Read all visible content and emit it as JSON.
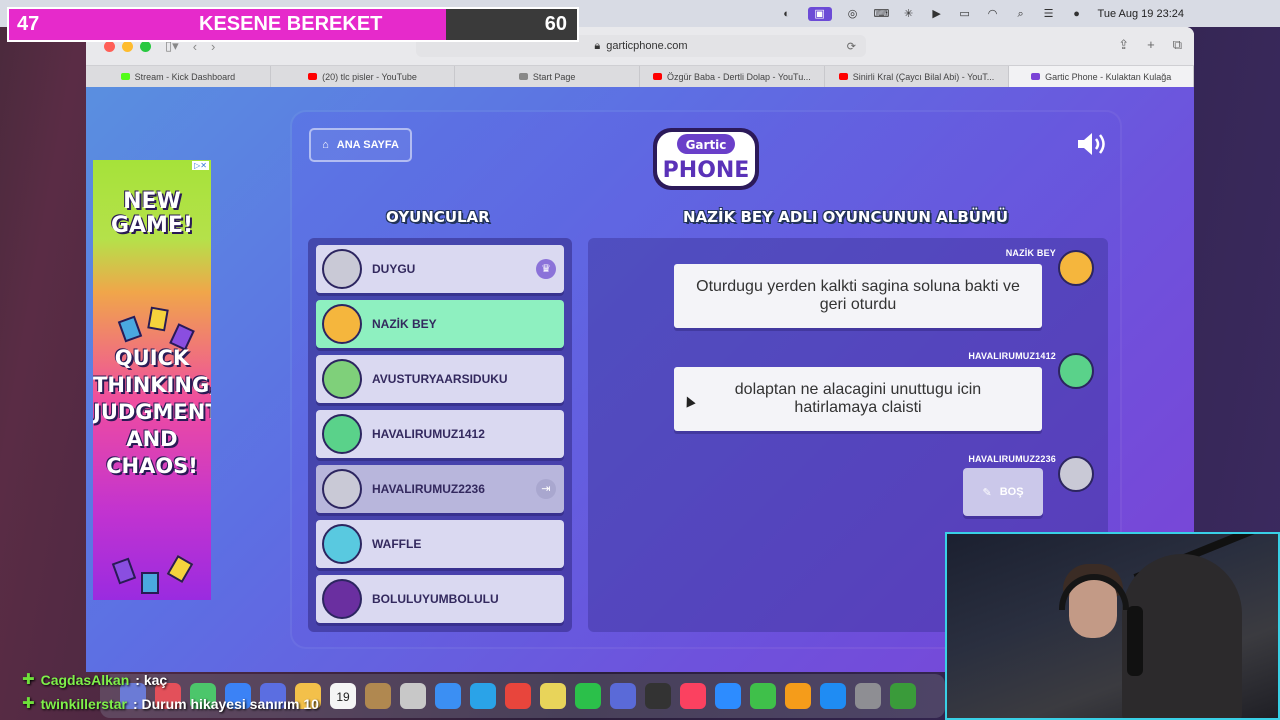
{
  "overlay": {
    "left_count": "47",
    "title": "KESENE BEREKET",
    "right_count": "60",
    "fill_fraction": 0.77
  },
  "menubar": {
    "clock": "Tue Aug 19  23:24"
  },
  "browser": {
    "url": "garticphone.com",
    "tabs": [
      {
        "label": "Stream - Kick Dashboard",
        "fav_color": "#53fc18"
      },
      {
        "label": "(20) tlc pisler - YouTube",
        "fav_color": "#ff0000"
      },
      {
        "label": "Start Page",
        "fav_color": "#888888"
      },
      {
        "label": "Özgür Baba - Dertli Dolap - YouTu...",
        "fav_color": "#ff0000"
      },
      {
        "label": "Sinirli Kral (Çaycı Bilal Abi) - YouT...",
        "fav_color": "#ff0000"
      },
      {
        "label": "Gartic Phone - Kulaktan Kulağa",
        "fav_color": "#7b43d6"
      }
    ]
  },
  "ad": {
    "headline": "NEW GAME!",
    "tagline": "QUICK THINKING, JUDGMENT AND CHAOS!"
  },
  "game": {
    "home_label": "ANA SAYFA",
    "logo_top": "Gartic",
    "logo_bottom": "PHONE",
    "players_title": "OYUNCULAR",
    "album_title": "NAZİK BEY ADLI OYUNCUNUN ALBÜMÜ",
    "players": [
      {
        "name": "DUYGU",
        "state": "normal",
        "badge": "crown",
        "avatar_color": "#c9c9d6"
      },
      {
        "name": "NAZİK BEY",
        "state": "active",
        "badge": "",
        "avatar_color": "#f5b63d"
      },
      {
        "name": "AVUSTURYAARSIDUKU",
        "state": "normal",
        "badge": "",
        "avatar_color": "#7fd07a"
      },
      {
        "name": "HAVALIRUMUZ1412",
        "state": "normal",
        "badge": "",
        "avatar_color": "#5ad28a"
      },
      {
        "name": "HAVALIRUMUZ2236",
        "state": "dim",
        "badge": "exit",
        "avatar_color": "#c9c9d6"
      },
      {
        "name": "WAFFLE",
        "state": "normal",
        "badge": "",
        "avatar_color": "#59c9e0"
      },
      {
        "name": "BOLULUYUMBOLULU",
        "state": "normal",
        "badge": "",
        "avatar_color": "#6a2fa0"
      }
    ],
    "album": [
      {
        "author": "NAZİK BEY",
        "text": "Oturdugu yerden kalkti sagina soluna bakti ve geri oturdu",
        "avatar_color": "#f5b63d"
      },
      {
        "author": "HAVALIRUMUZ1412",
        "text": "dolaptan ne alacagini unuttugu icin hatirlamaya claisti",
        "avatar_color": "#5ad28a"
      },
      {
        "author": "HAVALIRUMUZ2236",
        "text": "BOŞ",
        "avatar_color": "#c9c9d6"
      }
    ]
  },
  "chat": [
    {
      "user": "CagdasAlkan",
      "message": ": kaç"
    },
    {
      "user": "twinkillerstar",
      "message": ": Durum hikayesi sanırım 10"
    }
  ],
  "dock": {
    "date_icon_day": "19",
    "app_colors": [
      "#6b7bd6",
      "#e3505a",
      "#4cc66b",
      "#3b82f6",
      "#5b6ee1",
      "#f3c04a",
      "#d8d8d8",
      "#b08850",
      "#c8c8c8",
      "#3b8ff3",
      "#2aa3e8",
      "#e8453c",
      "#e8d45a",
      "#2bc04a",
      "#5a6ad8",
      "#333333",
      "#fb4160",
      "#2d8cff",
      "#3fc04a",
      "#f59c1a",
      "#1f8cf3",
      "#8e8e93",
      "#3a9b3a"
    ]
  }
}
